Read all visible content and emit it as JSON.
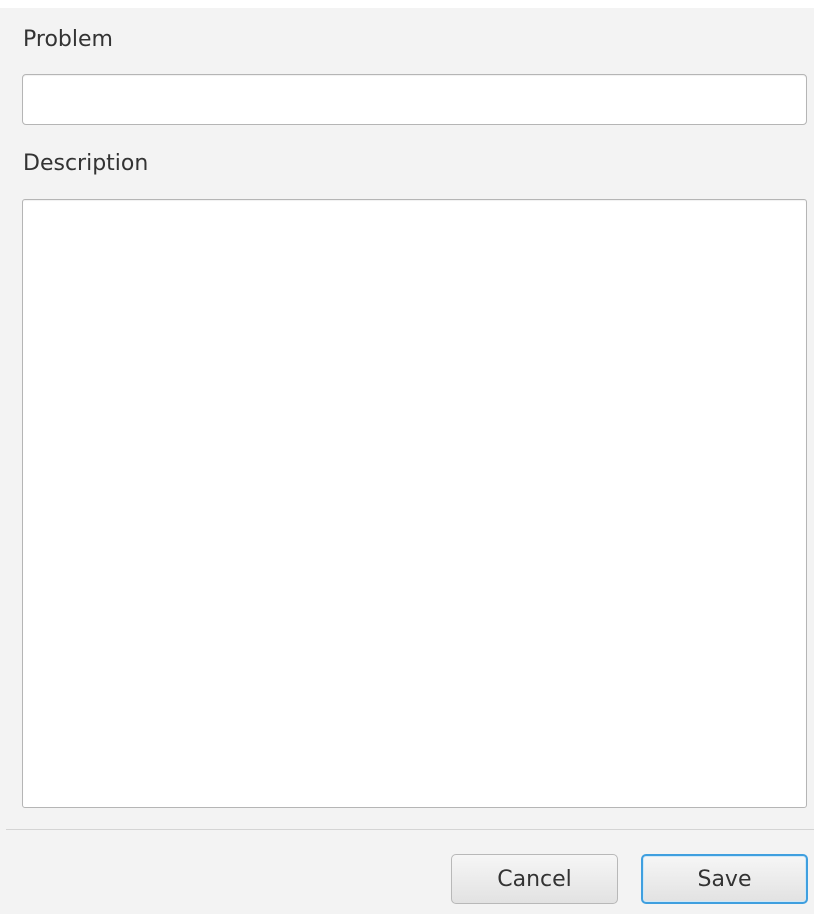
{
  "form": {
    "problem_label": "Problem",
    "problem_value": "",
    "description_label": "Description",
    "description_value": ""
  },
  "buttons": {
    "cancel_label": "Cancel",
    "save_label": "Save"
  },
  "colors": {
    "dialog_background": "#f3f3f3",
    "field_border": "#b5b5b5",
    "focus_accent": "#3f9fdf"
  }
}
